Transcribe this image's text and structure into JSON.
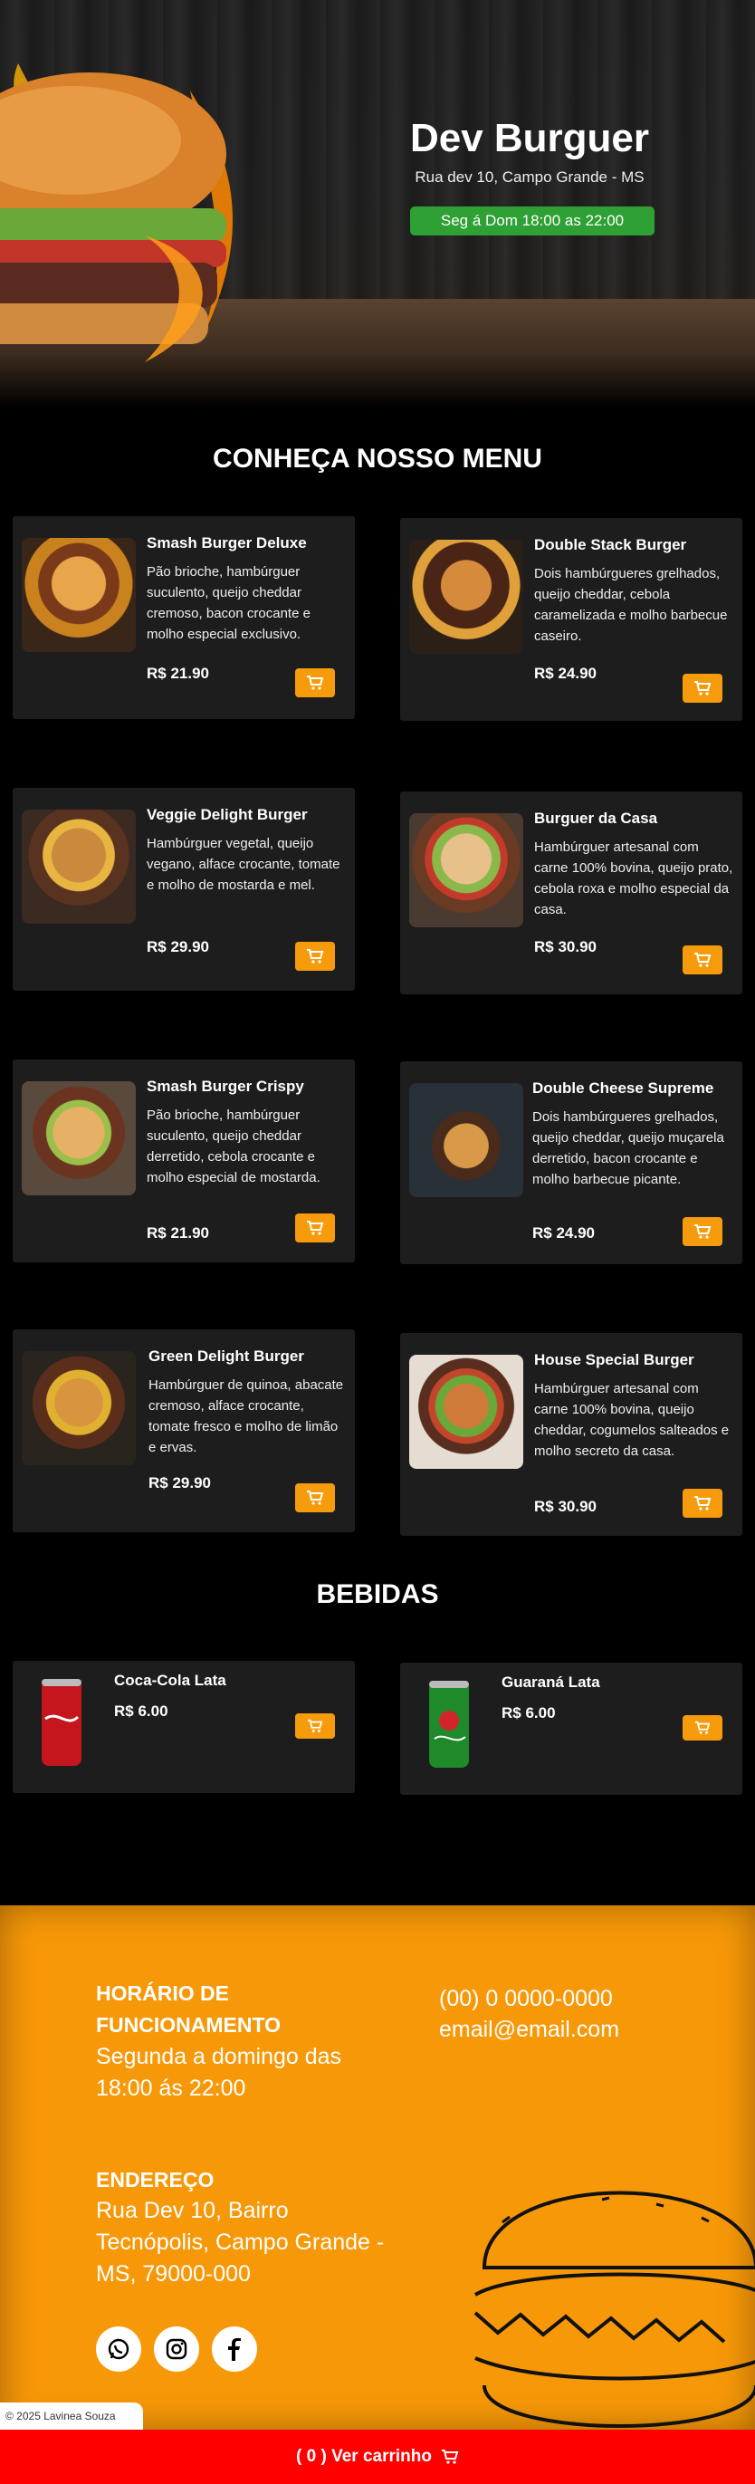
{
  "header": {
    "title": "Dev Burguer",
    "address": "Rua dev 10, Campo Grande - MS",
    "hours_badge": "Seg á Dom 18:00 as 22:00",
    "badge_color": "#2ea034"
  },
  "menu": {
    "title": "CONHEÇA NOSSO MENU",
    "items": [
      {
        "name": "Smash Burger Deluxe",
        "description": "Pão brioche, hambúrguer suculento, queijo cheddar cremoso, bacon crocante e molho especial exclusivo.",
        "price": "R$ 21.90"
      },
      {
        "name": "Double Stack Burger",
        "description": "Dois hambúrgueres grelhados, queijo cheddar, cebola caramelizada e molho barbecue caseiro.",
        "price": "R$ 24.90"
      },
      {
        "name": "Veggie Delight Burger",
        "description": "Hambúrguer vegetal, queijo vegano, alface crocante, tomate e molho de mostarda e mel.",
        "price": "R$ 29.90"
      },
      {
        "name": "Burguer da Casa",
        "description": "Hambúrguer artesanal com carne 100% bovina, queijo prato, cebola roxa e molho especial da casa.",
        "price": "R$ 30.90"
      },
      {
        "name": "Smash Burger Crispy",
        "description": "Pão brioche, hambúrguer suculento, queijo cheddar derretido, cebola crocante e molho especial de mostarda.",
        "price": "R$ 21.90"
      },
      {
        "name": "Double Cheese Supreme",
        "description": "Dois hambúrgueres grelhados, queijo cheddar, queijo muçarela derretido, bacon crocante e molho barbecue picante.",
        "price": "R$ 24.90"
      },
      {
        "name": "Green Delight Burger",
        "description": "Hambúrguer de quinoa, abacate cremoso, alface crocante, tomate fresco e molho de limão e ervas.",
        "price": "R$ 29.90"
      },
      {
        "name": "House Special Burger",
        "description": "Hambúrguer artesanal com carne 100% bovina, queijo cheddar, cogumelos salteados e molho secreto da casa.",
        "price": "R$ 30.90"
      }
    ]
  },
  "drinks": {
    "title": "BEBIDAS",
    "items": [
      {
        "name": "Coca-Cola Lata",
        "price": "R$ 6.00"
      },
      {
        "name": "Guaraná Lata",
        "price": "R$ 6.00"
      }
    ]
  },
  "footer": {
    "hours_heading": "HORÁRIO DE FUNCIONAMENTO",
    "hours_text": "Segunda a domingo das 18:00 ás 22:00",
    "phone": "(00) 0 0000-0000",
    "email": "email@email.com",
    "address_heading": "ENDEREÇO",
    "address_text": "Rua Dev 10, Bairro Tecnópolis, Campo Grande - MS, 79000-000",
    "social_icons": [
      "whatsapp-icon",
      "instagram-icon",
      "facebook-icon"
    ],
    "background_color": "#f79808"
  },
  "copyright": "© 2025 Lavinea Souza",
  "cart_bar": {
    "label": "( 0 ) Ver carrinho",
    "color": "#ff0000"
  },
  "accent_color": "#f69b0c"
}
